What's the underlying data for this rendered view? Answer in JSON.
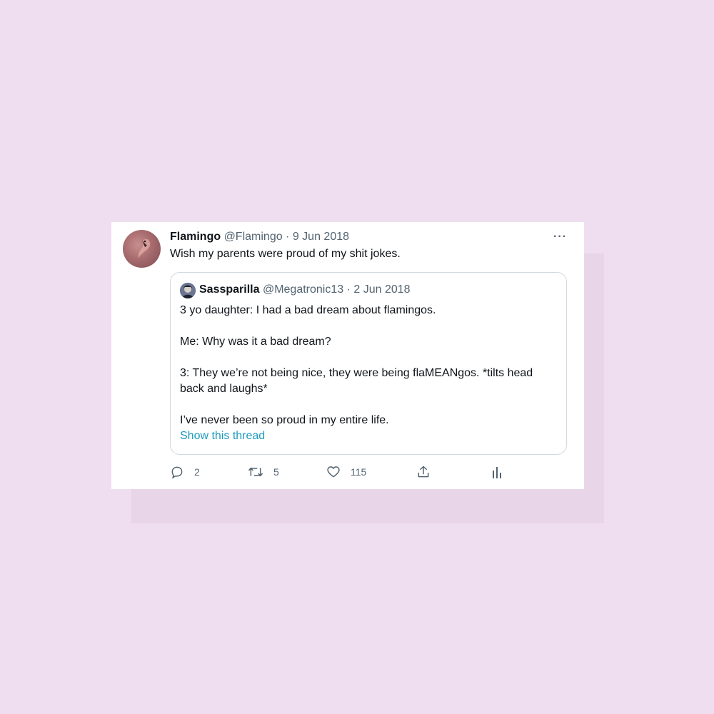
{
  "tweet": {
    "author_name": "Flamingo",
    "author_meta": "@Flamingo · 9 Jun 2018",
    "text": "Wish my parents were proud of my shit jokes.",
    "more_label": "···"
  },
  "quoted_tweet": {
    "author_name": "Sassparilla",
    "author_meta": "@Megatronic13 · 2 Jun 2018",
    "lines": [
      "3 yo daughter: I had a bad dream about flamingos.",
      "Me: Why was it a bad dream?",
      "3: They we’re not being nice, they were being flaMEANgos. *tilts head back and laughs*",
      "I’ve never been so proud in my entire life."
    ],
    "show_thread_label": "Show this thread"
  },
  "actions": {
    "reply_icon": "reply-icon",
    "reply_count": "2",
    "retweet_icon": "retweet-icon",
    "retweet_count": "5",
    "like_icon": "heart-icon",
    "like_count": "115",
    "share_icon": "share-icon",
    "analytics_icon": "analytics-icon"
  },
  "colors": {
    "background": "#efdef0",
    "card": "#ffffff",
    "link": "#1d9bbd",
    "muted_text": "#536471"
  }
}
